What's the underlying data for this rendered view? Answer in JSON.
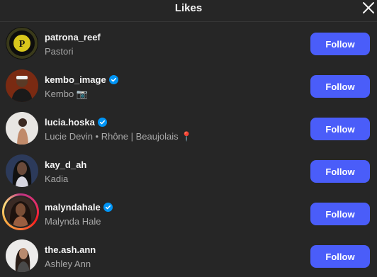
{
  "header": {
    "title": "Likes",
    "close_icon": "close-icon"
  },
  "accent": "#4a5df9",
  "users": [
    {
      "username": "patrona_reef",
      "fullname": "Pastori",
      "verified": false,
      "follow_label": "Follow"
    },
    {
      "username": "kembo_image",
      "fullname": "Kembo 📷",
      "verified": true,
      "follow_label": "Follow"
    },
    {
      "username": "lucia.hoska",
      "fullname": "Lucie Devin • Rhône | Beaujolais 📍",
      "verified": true,
      "follow_label": "Follow"
    },
    {
      "username": "kay_d_ah",
      "fullname": "Kadia",
      "verified": false,
      "follow_label": "Follow"
    },
    {
      "username": "malyndahale",
      "fullname": "Malynda Hale",
      "verified": true,
      "story_ring": true,
      "follow_label": "Follow"
    },
    {
      "username": "the.ash.ann",
      "fullname": "Ashley Ann",
      "verified": false,
      "follow_label": "Follow"
    }
  ]
}
